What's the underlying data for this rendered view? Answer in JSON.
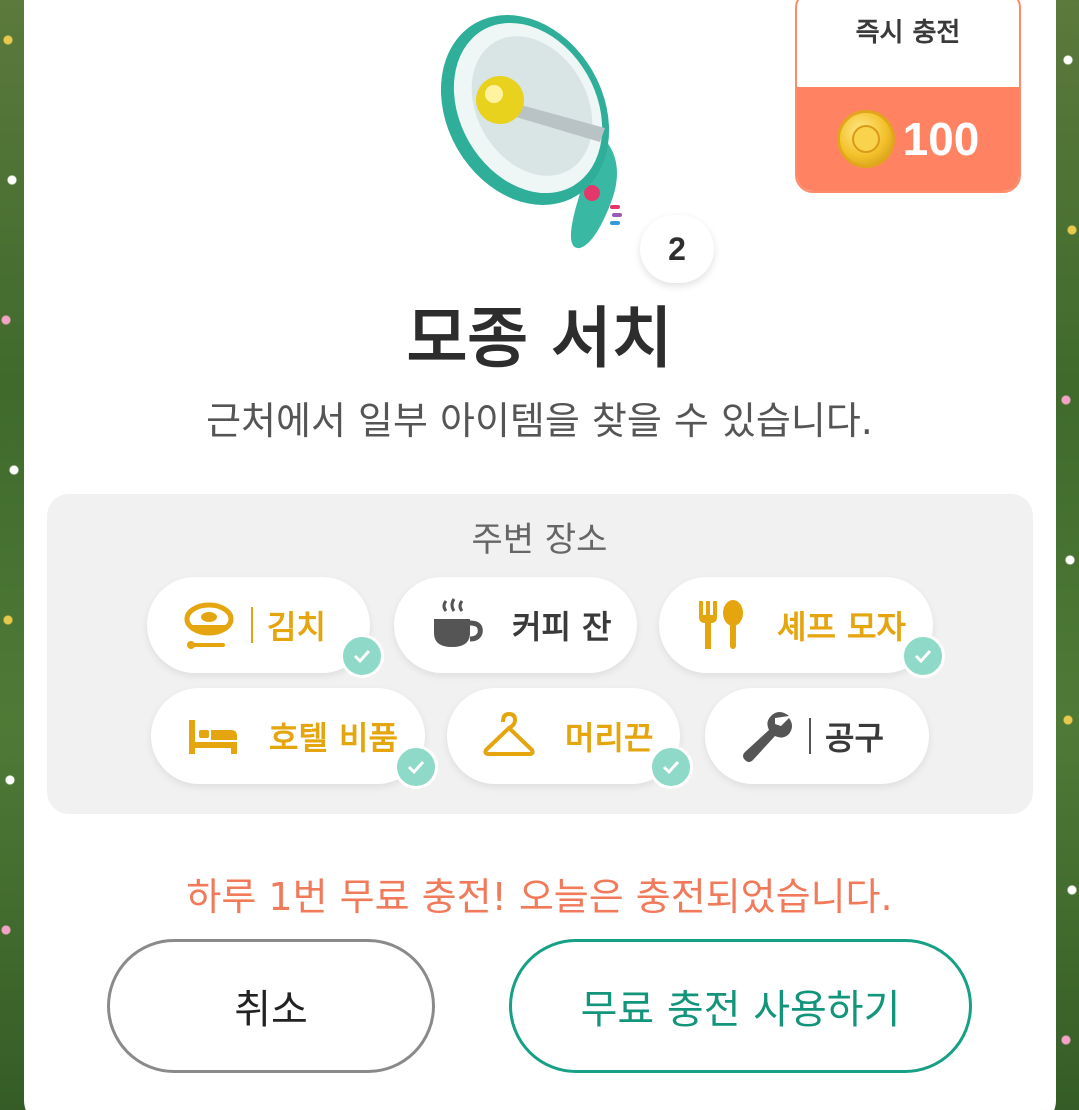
{
  "dialog": {
    "title": "모종 서치",
    "description": "근처에서 일부 아이템을 찾을 수 있습니다.",
    "level": "2"
  },
  "instant_charge": {
    "label": "즉시 충전",
    "amount": "100",
    "icon": "gold-coin-icon"
  },
  "nearby": {
    "title": "주변 장소",
    "items": [
      {
        "label": "김치",
        "icon": "kimchi-bowl-icon",
        "found": true
      },
      {
        "label": "커피 잔",
        "icon": "coffee-cup-icon",
        "found": false
      },
      {
        "label": "셰프 모자",
        "icon": "fork-spoon-icon",
        "found": true
      },
      {
        "label": "호텔 비품",
        "icon": "bed-icon",
        "found": true
      },
      {
        "label": "머리끈",
        "icon": "hanger-icon",
        "found": true
      },
      {
        "label": "공구",
        "icon": "wrench-icon",
        "found": false
      }
    ]
  },
  "notice": "하루 1번 무료 충전! 오늘은 충전되었습니다.",
  "buttons": {
    "cancel": "취소",
    "free_charge": "무료 충전 사용하기"
  },
  "colors": {
    "found": "#e5a50e",
    "check": "#8ed9c8",
    "charge": "#ff8262",
    "notice": "#f07a5a",
    "primary": "#16a085"
  }
}
